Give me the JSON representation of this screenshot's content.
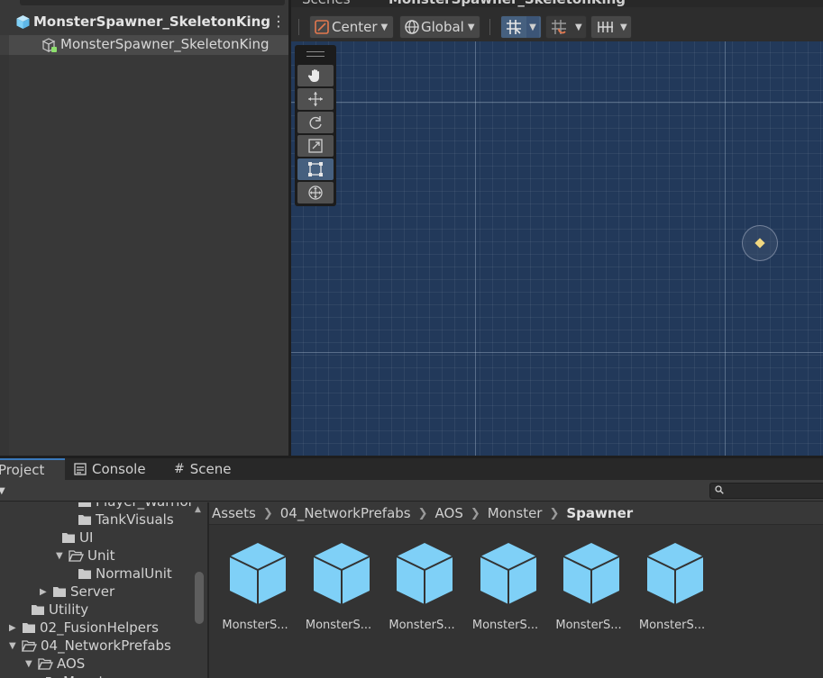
{
  "hierarchy": {
    "root_label": "MonsterSpawner_SkeletonKing",
    "child_label": "MonsterSpawner_SkeletonKing",
    "menu_glyph": "⋮"
  },
  "scene": {
    "tab_scenes": "Scenes",
    "tab_prefab": "MonsterSpawner_SkeletonKing",
    "pivot_mode": "Center",
    "pivot_rotation": "Global"
  },
  "bottom_tabs": {
    "project": "Project",
    "console": "Console",
    "scene": "Scene"
  },
  "tree": {
    "items": [
      {
        "label": "Player_Warrior",
        "indent": 80
      },
      {
        "label": "TankVisuals",
        "indent": 80
      },
      {
        "label": "UI",
        "indent": 62
      },
      {
        "label": "Unit",
        "indent": 62,
        "arrow": "▼"
      },
      {
        "label": "NormalUnit",
        "indent": 80
      },
      {
        "label": "Server",
        "indent": 44,
        "arrow": "▶"
      },
      {
        "label": "Utility",
        "indent": 28
      },
      {
        "label": "02_FusionHelpers",
        "indent": 10,
        "arrow": "▶"
      },
      {
        "label": "04_NetworkPrefabs",
        "indent": 10,
        "arrow": "▼"
      },
      {
        "label": "AOS",
        "indent": 28,
        "arrow": "▼"
      },
      {
        "label": "Monster",
        "indent": 44
      }
    ]
  },
  "breadcrumb": {
    "items": [
      "Assets",
      "04_NetworkPrefabs",
      "AOS",
      "Monster"
    ],
    "current": "Spawner"
  },
  "assets": {
    "items": [
      "MonsterS...",
      "MonsterS...",
      "MonsterS...",
      "MonsterS...",
      "MonsterS...",
      "MonsterS..."
    ]
  },
  "colors": {
    "prefab_blue": "#7fd0f7",
    "viewport_bg": "#22395a",
    "active_tab_accent": "#3a79bb",
    "selected_tool": "#46607f"
  }
}
